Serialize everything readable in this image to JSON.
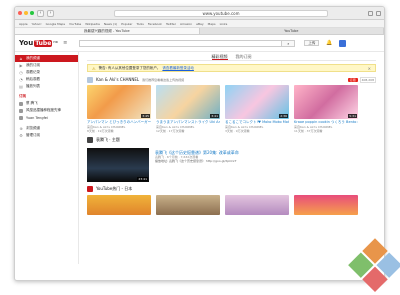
{
  "browser": {
    "url": "www.youtube.com",
    "bookmarks": [
      "Apple",
      "Yahoo!",
      "Google Maps",
      "YouTube",
      "Wikipedia",
      "News (1)",
      "Popular",
      "Tools",
      "Facebook",
      "Twitter",
      "Amazon",
      "eBay",
      "Maps",
      "Links"
    ],
    "tabs": [
      "我最感兴趣的视频 - YouTube",
      "YouTube"
    ]
  },
  "header": {
    "logo": "You",
    "logo_box": "Tube",
    "region": "HK",
    "menu_icon": "≡",
    "search_placeholder": "",
    "search_icon": "⌕",
    "upload": "上传",
    "bell_icon": "🔔"
  },
  "sidebar": {
    "items": [
      {
        "icon": "⌂",
        "label": "我的频道"
      },
      {
        "icon": "▶",
        "label": "我的订阅"
      },
      {
        "icon": "◷",
        "label": "观看记录"
      },
      {
        "icon": "◔",
        "label": "稍后观看"
      },
      {
        "icon": "▤",
        "label": "播放列表"
      }
    ],
    "subs_head": "订阅",
    "subs": [
      "蔡 腾飞",
      "风靡品撞播种程度先锋",
      "Yuan Tengfei"
    ],
    "extra": [
      {
        "icon": "⊕",
        "label": "浏览频道"
      },
      {
        "icon": "⚙",
        "label": "管理订阅"
      }
    ]
  },
  "main": {
    "tabs": [
      "精彩视频",
      "我的订阅"
    ],
    "warning": {
      "text": "警告: 有人从其他位置登录了您的帐户。",
      "link": "请查看最新登录活动",
      "close": "×"
    },
    "shelf1": {
      "channel": "Kan & Aki's CHANNEL",
      "sub": "我们推荐您看看这些上传的视频",
      "subscribe": "订阅",
      "subscribe_count": "408,208",
      "cards": [
        {
          "title": "アンパンマン とびっきりのハンバーガー Anpanman",
          "meta": "来自Kan & Aki's CHANNEL",
          "views": "8天前 · 19万次观看",
          "duration": "3:45"
        },
        {
          "title": "うまうまアンパンマンストライク Uki Anpanman",
          "meta": "来自Kan & Aki's CHANNEL",
          "views": "12天前 · 17万次观看",
          "duration": "3:41"
        },
        {
          "title": "るこるこでコレクト!♥ Moko Moko Mokolecto",
          "meta": "来自Kan & Aki's CHANNEL",
          "views": "3天前 · 9万次观看",
          "duration": "2:36"
        },
        {
          "title": "Kraoe poppin cookin つくろう Bento candy",
          "meta": "来自Kan & Aki's CHANNEL",
          "views": "11天前 · 37万次观看",
          "duration": "5:31"
        }
      ]
    },
    "shelf2": {
      "channel": "袁腾飞 · 主题",
      "feature": {
        "title": "袁腾飞《这个历史挺靠谱》第20集: 改革或革命",
        "meta": "袁腾飞 · 6个月前 · 7,632次观看",
        "desc": "播放地址: 袁腾飞《这个历史挺靠谱》 http://goo.gl/XpOrxT",
        "duration": "23:41"
      }
    },
    "shelf3": {
      "channel": "YouTube热门 - 日本"
    }
  },
  "colors": {
    "accent": "#cc181e",
    "link": "#167ac6",
    "warning_bg": "#fff7c6"
  }
}
